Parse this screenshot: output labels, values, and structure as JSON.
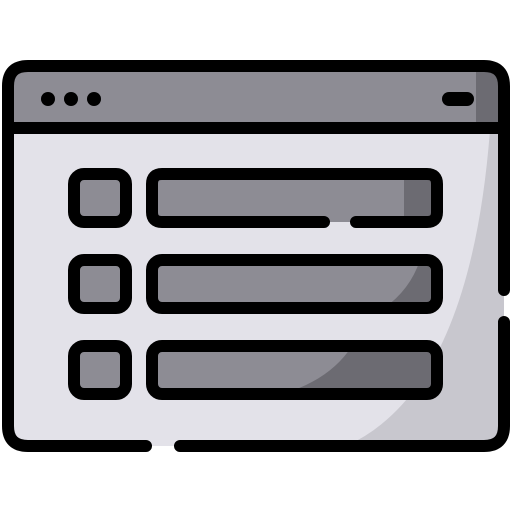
{
  "window": {
    "title_bar_controls": [
      "dot-icon",
      "dot-icon",
      "dot-icon"
    ],
    "title_bar_button": "minimize-pill-icon"
  },
  "list": {
    "rows": [
      {
        "checkbox": "square-icon",
        "bar": "text-line-placeholder"
      },
      {
        "checkbox": "square-icon",
        "bar": "text-line-placeholder"
      },
      {
        "checkbox": "square-icon",
        "bar": "text-line-placeholder"
      }
    ]
  },
  "colors": {
    "outline": "#000000",
    "title_bar": "#8d8c94",
    "title_bar_shade": "#6c6b72",
    "window_body": "#e3e2e9",
    "window_body_shade": "#c8c7ce",
    "element_fill": "#8d8c94",
    "element_shade": "#6c6b72"
  }
}
